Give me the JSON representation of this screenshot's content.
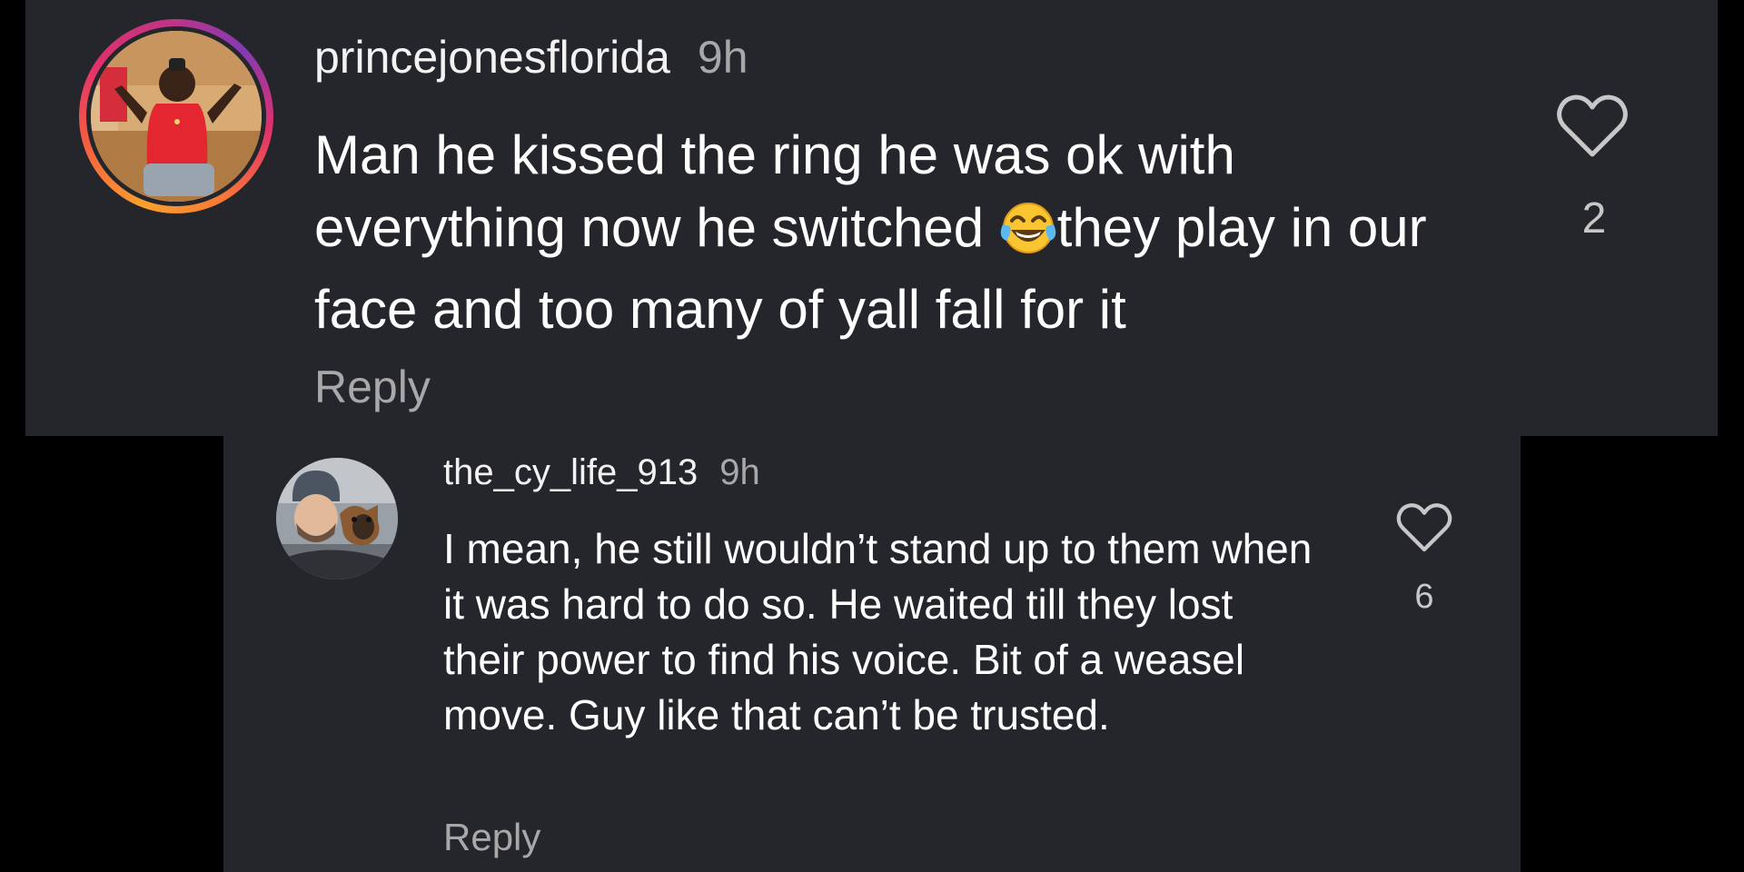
{
  "colors": {
    "background": "#000000",
    "card": "#25262b",
    "primary_text": "#ffffff",
    "secondary_text": "#a8a8a8",
    "story_ring": [
      "#f9a12e",
      "#e1306c",
      "#833ab4"
    ]
  },
  "comments": [
    {
      "username": "princejonesflorida",
      "time": "9h",
      "text_before_emoji": "Man he kissed the ring he was ok with everything now he switched ",
      "emoji": "face-with-tears-of-joy",
      "text_after_emoji": "they play in our face and too many of yall fall for it",
      "reply_label": "Reply",
      "like_icon": "heart-outline-icon",
      "like_count": "2",
      "has_story_ring": true
    },
    {
      "username": "the_cy_life_913",
      "time": "9h",
      "text": "I mean, he still wouldn’t stand up to them when it was hard to do so. He waited till they lost their power to find his voice. Bit of a weasel move. Guy like that can’t be trusted.",
      "reply_label": "Reply",
      "like_icon": "heart-outline-icon",
      "like_count": "6",
      "has_story_ring": false
    }
  ]
}
